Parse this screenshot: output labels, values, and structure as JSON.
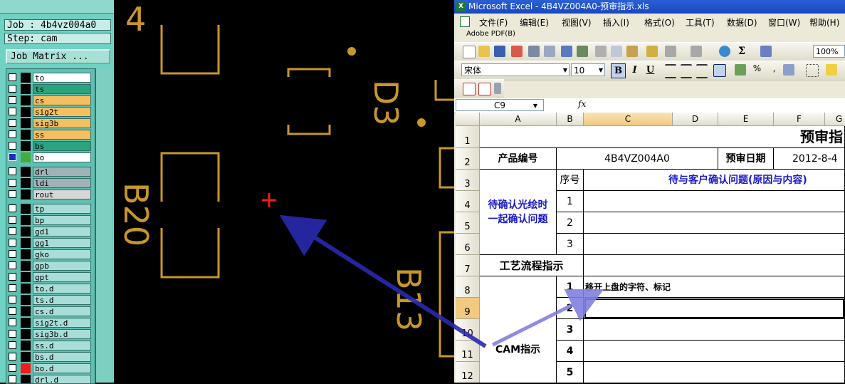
{
  "cam": {
    "job_label": "Job : 4b4vz004a0",
    "step_label": "Step: cam",
    "job_matrix_label": "Job Matrix ...",
    "layers": [
      {
        "name": "to",
        "color": "#ffffff",
        "swatch": "#000000"
      },
      {
        "name": "ts",
        "color": "#2aa37f",
        "swatch": "#000000"
      },
      {
        "name": "cs",
        "color": "#f5bf5f",
        "swatch": "#000000"
      },
      {
        "name": "sig2t",
        "color": "#f5bf5f",
        "swatch": "#000000"
      },
      {
        "name": "sig3b",
        "color": "#f5bf5f",
        "swatch": "#000000"
      },
      {
        "name": "ss",
        "color": "#f5bf5f",
        "swatch": "#000000"
      },
      {
        "name": "bs",
        "color": "#2aa37f",
        "swatch": "#000000"
      },
      {
        "name": "bo",
        "color": "#ffffff",
        "swatch": "#3fae3f",
        "active": true
      },
      {
        "name": "drl",
        "color": "#9fb3b6",
        "swatch": "#000000"
      },
      {
        "name": "ldi",
        "color": "#9fb3b6",
        "swatch": "#000000"
      },
      {
        "name": "rout",
        "color": "#d6d6d6",
        "swatch": "#000000"
      },
      {
        "name": "tp",
        "color": "#a9ddd8",
        "swatch": "#000000"
      },
      {
        "name": "bp",
        "color": "#a9ddd8",
        "swatch": "#000000"
      },
      {
        "name": "gd1",
        "color": "#a9ddd8",
        "swatch": "#000000"
      },
      {
        "name": "gg1",
        "color": "#a9ddd8",
        "swatch": "#000000"
      },
      {
        "name": "gko",
        "color": "#a9ddd8",
        "swatch": "#000000"
      },
      {
        "name": "gpb",
        "color": "#a9ddd8",
        "swatch": "#000000"
      },
      {
        "name": "gpt",
        "color": "#a9ddd8",
        "swatch": "#000000"
      },
      {
        "name": "to.d",
        "color": "#a9ddd8",
        "swatch": "#000000"
      },
      {
        "name": "ts.d",
        "color": "#a9ddd8",
        "swatch": "#000000"
      },
      {
        "name": "cs.d",
        "color": "#a9ddd8",
        "swatch": "#000000"
      },
      {
        "name": "sig2t.d",
        "color": "#a9ddd8",
        "swatch": "#000000"
      },
      {
        "name": "sig3b.d",
        "color": "#a9ddd8",
        "swatch": "#000000"
      },
      {
        "name": "ss.d",
        "color": "#a9ddd8",
        "swatch": "#000000"
      },
      {
        "name": "bs.d",
        "color": "#a9ddd8",
        "swatch": "#000000"
      },
      {
        "name": "bo.d",
        "color": "#a9ddd8",
        "swatch": "#ee1c1c"
      },
      {
        "name": "drl.d",
        "color": "#a9ddd8",
        "swatch": "#000000"
      }
    ],
    "canvas_labels": {
      "ref_d3": "D3",
      "ref_b20": "B20",
      "ref_b13": "B13",
      "ref_4": "4"
    },
    "colors": {
      "pad": "#c8962a",
      "cursor": "#ee1c1c",
      "arrow": "#2a2ab0"
    }
  },
  "excel": {
    "title": "Microsoft Excel - 4B4VZ004A0-预审指示.xls",
    "menu": [
      "文件(F)",
      "编辑(E)",
      "视图(V)",
      "插入(I)",
      "格式(O)",
      "工具(T)",
      "数据(D)",
      "窗口(W)",
      "帮助(H)"
    ],
    "menu_adobe": "Adobe PDF(B)",
    "font_name": "宋体",
    "font_size": "10",
    "zoom": "100%",
    "name_box": "C9",
    "fx": "fx",
    "columns": [
      "A",
      "B",
      "C",
      "D",
      "E",
      "F",
      "G"
    ],
    "rows": [
      "1",
      "2",
      "3",
      "4",
      "5",
      "6",
      "7",
      "8",
      "9",
      "10",
      "11",
      "12"
    ],
    "cells": {
      "title": "预审指",
      "product_no_label": "产品编号",
      "product_no": "4B4VZ004A0",
      "review_date_label": "预审日期",
      "review_date": "2012-8-4",
      "seq_label": "序号",
      "pending_header": "待与客户确认问题(原因与内容)",
      "confirm_label_1": "待确认光绘时",
      "confirm_label_2": "一起确认问题",
      "seq_1": "1",
      "seq_2": "2",
      "seq_3": "3",
      "process_label": "工艺流程指示",
      "cam_seq_1": "1",
      "cam_seq_2": "2",
      "cam_seq_3": "3",
      "cam_seq_4": "4",
      "cam_seq_5": "5",
      "cam_item_1": "移开上盘的字符、标记",
      "cam_label": "CAM指示"
    }
  }
}
